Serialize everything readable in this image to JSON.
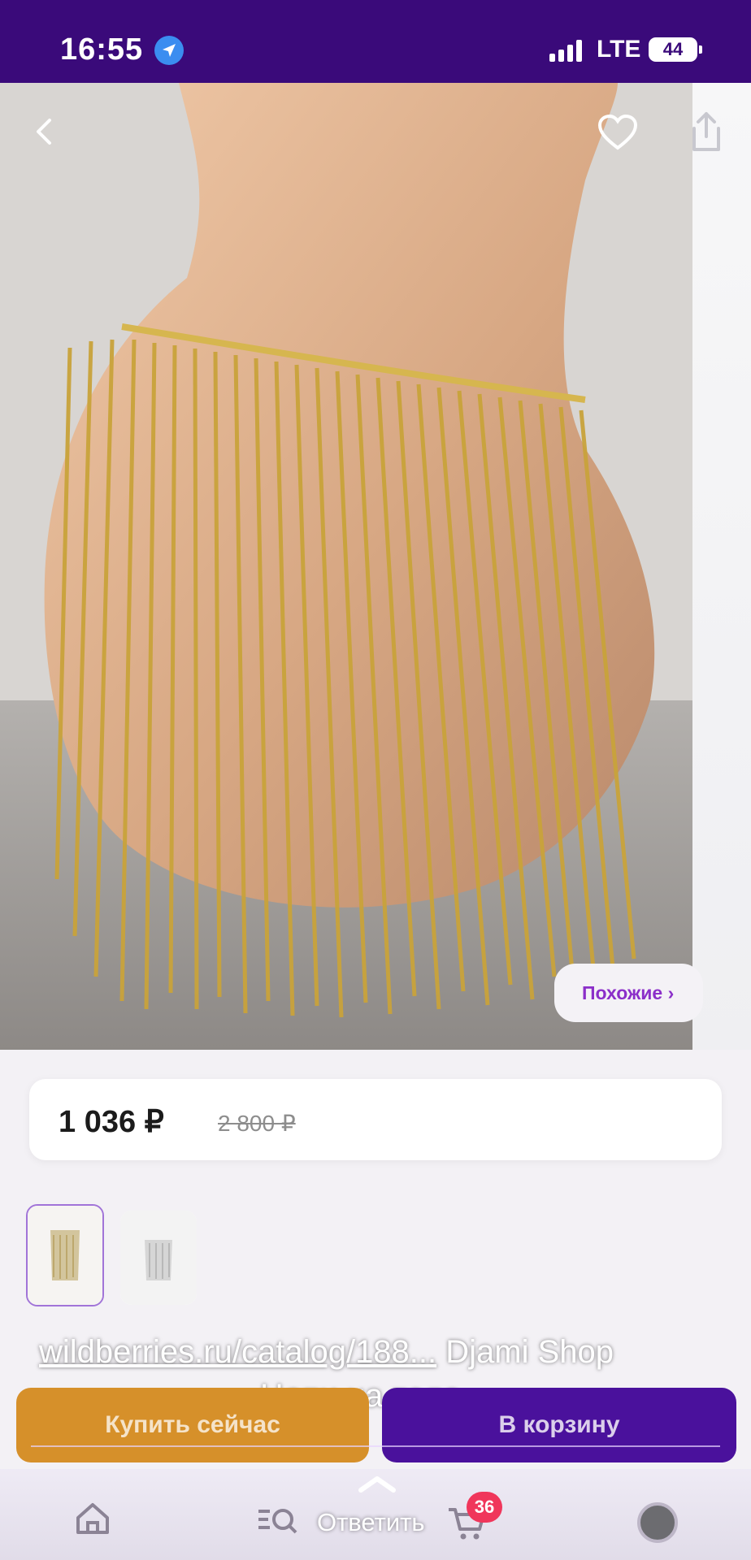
{
  "status_bar": {
    "time": "16:55",
    "network": "LTE",
    "battery": "44"
  },
  "product": {
    "price": "1 036 ₽",
    "old_price": "2 800 ₽",
    "similar_label": "Похожие ›"
  },
  "overlay": {
    "link_text": "wildberries.ru/catalog/188...",
    "shop_text": "Djami Shop",
    "caption": "Цепи на тело"
  },
  "buttons": {
    "buy_now": "Купить сейчас",
    "add_to_cart": "В корзину"
  },
  "tabbar": {
    "reply_label": "Ответить",
    "cart_badge": "36"
  },
  "colors": {
    "brand_purple": "#3a0a7a",
    "cart_button": "#4a119c",
    "buy_button": "#d6902a",
    "badge": "#f0365b"
  },
  "icons": [
    "location-arrow-icon",
    "signal-icon",
    "back-icon",
    "heart-icon",
    "share-icon",
    "home-icon",
    "search-icon",
    "cart-icon",
    "chevron-up-icon"
  ]
}
